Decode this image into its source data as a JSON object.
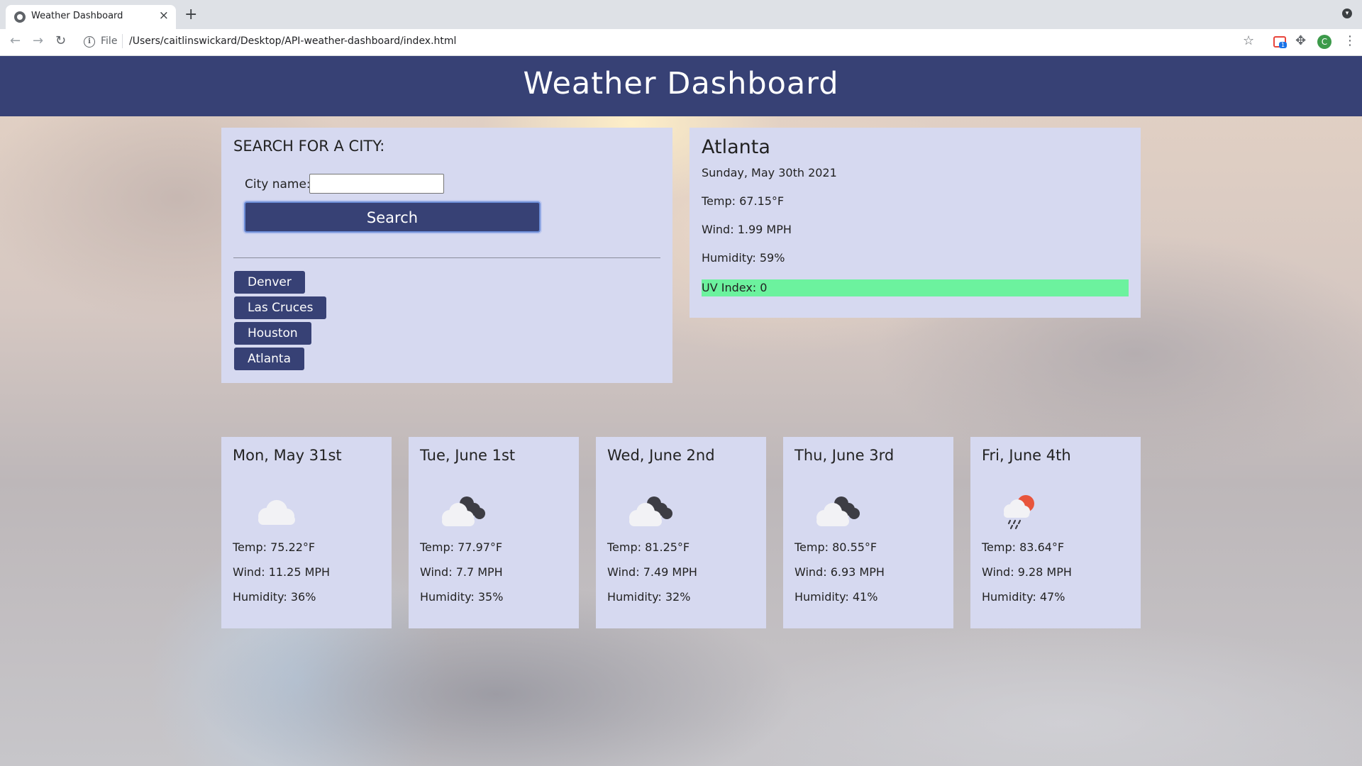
{
  "browser": {
    "tab_title": "Weather Dashboard",
    "file_label": "File",
    "url": "/Users/caitlinswickard/Desktop/API-weather-dashboard/index.html",
    "avatar_letter": "C",
    "extension_badge": "1"
  },
  "header": {
    "title": "Weather Dashboard"
  },
  "search": {
    "heading": "SEARCH FOR A CITY:",
    "city_label": "City name:",
    "input_value": "",
    "button_label": "Search",
    "history": [
      "Denver",
      "Las Cruces",
      "Houston",
      "Atlanta"
    ]
  },
  "current": {
    "city": "Atlanta",
    "date": "Sunday, May 30th 2021",
    "temp": "Temp: 67.15°F",
    "wind": "Wind: 1.99 MPH",
    "humidity": "Humidity: 59%",
    "uv": "UV Index: 0",
    "uv_color": "#6cf29e"
  },
  "forecast": [
    {
      "date": "Mon, May 31st",
      "icon": "cloud-icon",
      "temp": "Temp: 75.22°F",
      "wind": "Wind: 11.25 MPH",
      "humidity": "Humidity: 36%"
    },
    {
      "date": "Tue, June 1st",
      "icon": "broken-clouds-icon",
      "temp": "Temp: 77.97°F",
      "wind": "Wind: 7.7 MPH",
      "humidity": "Humidity: 35%"
    },
    {
      "date": "Wed, June 2nd",
      "icon": "broken-clouds-icon",
      "temp": "Temp: 81.25°F",
      "wind": "Wind: 7.49 MPH",
      "humidity": "Humidity: 32%"
    },
    {
      "date": "Thu, June 3rd",
      "icon": "broken-clouds-icon",
      "temp": "Temp: 80.55°F",
      "wind": "Wind: 6.93 MPH",
      "humidity": "Humidity: 41%"
    },
    {
      "date": "Fri, June 4th",
      "icon": "rain-sun-icon",
      "temp": "Temp: 83.64°F",
      "wind": "Wind: 9.28 MPH",
      "humidity": "Humidity: 47%"
    }
  ],
  "colors": {
    "header_bg": "#374175",
    "panel_bg": "#d6d9f0",
    "button_bg": "#374175"
  }
}
